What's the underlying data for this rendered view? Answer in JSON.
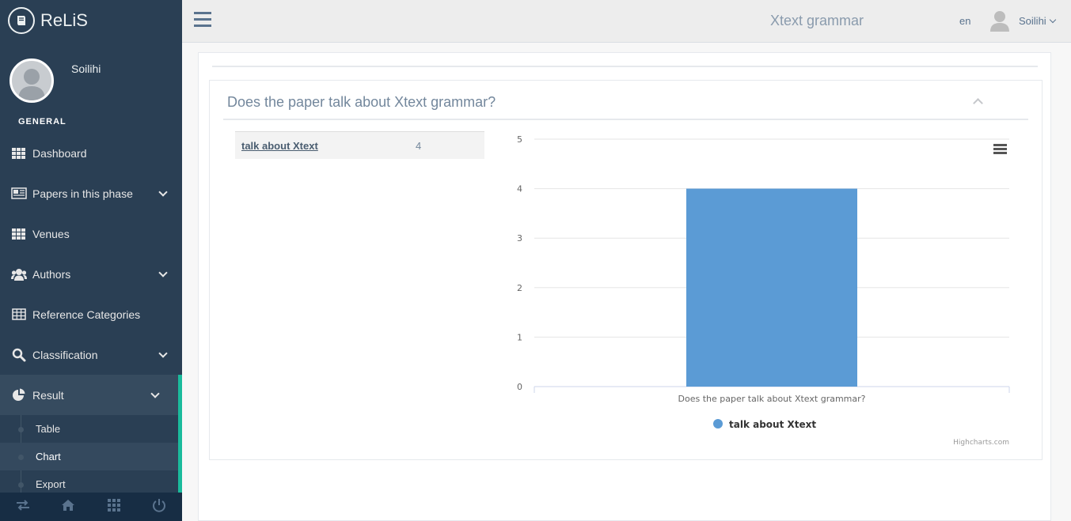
{
  "app": {
    "name": "ReLiS"
  },
  "profile": {
    "name": "Soilihi"
  },
  "sidebar": {
    "section_title": "GENERAL",
    "items": [
      {
        "label": "Dashboard",
        "icon": "grid-icon",
        "has_chevron": false
      },
      {
        "label": "Papers in this phase",
        "icon": "newspaper-icon",
        "has_chevron": true
      },
      {
        "label": "Venues",
        "icon": "grid-icon",
        "has_chevron": false
      },
      {
        "label": "Authors",
        "icon": "users-icon",
        "has_chevron": true
      },
      {
        "label": "Reference Categories",
        "icon": "table-icon",
        "has_chevron": false
      },
      {
        "label": "Classification",
        "icon": "search-icon",
        "has_chevron": true
      },
      {
        "label": "Result",
        "icon": "pie-chart-icon",
        "has_chevron": true,
        "active": true
      }
    ],
    "result_submenu": [
      {
        "label": "Table"
      },
      {
        "label": "Chart",
        "current": true
      },
      {
        "label": "Export"
      }
    ],
    "footer_icons": [
      "swap-icon",
      "home-icon",
      "apps-icon",
      "power-icon"
    ]
  },
  "topnav": {
    "title": "Xtext grammar",
    "lang": "en",
    "user_name": "Soilihi"
  },
  "panel": {
    "title": "Does the paper talk about Xtext grammar?",
    "summary": {
      "label": "talk about Xtext",
      "value": "4"
    }
  },
  "chart_data": {
    "type": "bar",
    "categories": [
      "Does the paper talk about Xtext grammar?"
    ],
    "series": [
      {
        "name": "talk about Xtext",
        "values": [
          4
        ],
        "color": "#5B9BD5"
      }
    ],
    "ylim": [
      0,
      5
    ],
    "yticks": [
      0,
      1,
      2,
      3,
      4,
      5
    ],
    "grid": true,
    "legend": "bottom-center",
    "credits": "Highcharts.com"
  },
  "colors": {
    "sidebar_bg": "#2A3F54",
    "accent": "#1ABB9C",
    "bar": "#5B9BD5"
  }
}
